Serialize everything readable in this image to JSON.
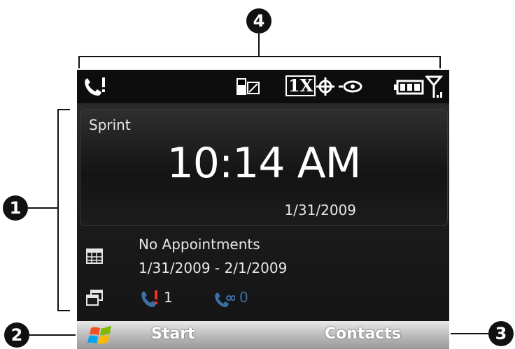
{
  "callouts": {
    "one": "1",
    "two": "2",
    "three": "3",
    "four": "4"
  },
  "status_bar": {
    "icons": [
      "phone-alert-icon",
      "sim-icon",
      "1x-data-icon",
      "gps-icon",
      "roaming-icon",
      "battery-icon",
      "signal-icon"
    ],
    "data_label": "1X"
  },
  "today": {
    "carrier": "Sprint",
    "time": "10:14 AM",
    "date": "1/31/2009",
    "appointments_title": "No Appointments",
    "appointments_range": "1/31/2009 - 2/1/2009",
    "missed_calls": "1",
    "voicemail": "0"
  },
  "softkeys": {
    "left": "Start",
    "right": "Contacts"
  },
  "colors": {
    "missed_call": "#ff2a2a",
    "voicemail": "#3b6fa6",
    "screen_bg": "#000000"
  }
}
